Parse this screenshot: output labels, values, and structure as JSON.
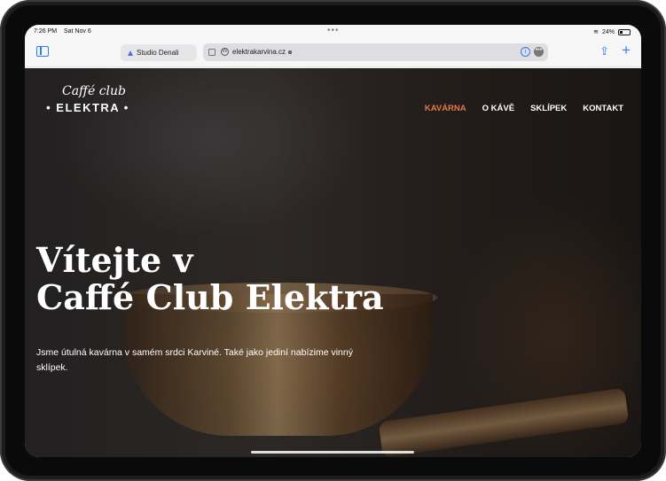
{
  "status": {
    "time": "7:26 PM",
    "date": "Sat Nov 6",
    "battery": "24%"
  },
  "browser": {
    "tab_group": "Studio Denali",
    "url": "elektrakarvina.cz"
  },
  "site": {
    "logo_script": "Caffé club",
    "logo_main": "• ELEKTRA •",
    "nav": [
      "KAVÁRNA",
      "O KÁVĚ",
      "SKLÍPEK",
      "KONTAKT"
    ],
    "hero_title_line1": "Vítejte v",
    "hero_title_line2": "Caffé Club Elektra",
    "hero_text": "Jsme útulná kavárna v samém srdci Karviné. Také jako jediní nabízime vinný sklípek."
  },
  "colors": {
    "accent": "#e27a47",
    "browser_blue": "#2e7cf6"
  },
  "icons": [
    "sidebar-icon",
    "wordpress-icon",
    "lock-icon",
    "info-icon",
    "more-icon",
    "share-icon",
    "plus-icon",
    "wifi-icon",
    "battery-icon"
  ]
}
